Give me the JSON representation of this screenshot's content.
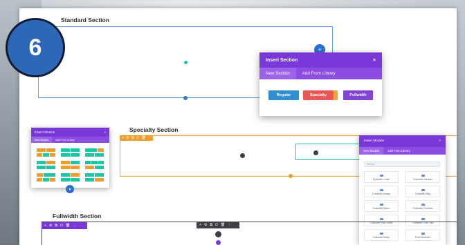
{
  "sections": {
    "standard": {
      "label": "Standard Section"
    },
    "specialty": {
      "label": "Specialty Section",
      "toolbar": "+ ⚙ ⧉ ⏻ 🗑 ⋮"
    },
    "fullwidth": {
      "label": "Fullwidth Section",
      "toolbar_left": "+ ⚙ ⧉ ⏻ 🗑 ⋮",
      "toolbar_mid": "+ ⚙ ⧉ ⏻ 🗑 ⋮"
    }
  },
  "step_badge": "6",
  "insert_section": {
    "title": "Insert Section",
    "close": "×",
    "tabs": [
      "New Section",
      "Add From Library"
    ],
    "buttons": {
      "regular": "Regular",
      "specialty": "Specialty",
      "fullwidth": "Fullwidth"
    }
  },
  "insert_columns": {
    "title": "Insert Columns",
    "close": "×",
    "tabs": [
      "New Module",
      "Add From Library"
    ]
  },
  "insert_module": {
    "title": "Insert Module",
    "close": "×",
    "tabs": [
      "New Module",
      "Add From Library"
    ],
    "search_placeholder": "Search",
    "modules": [
      "Fullwidth Code",
      "Fullwidth Header",
      "Fullwidth Image",
      "Fullwidth Map",
      "Fullwidth Menu",
      "Fullwidth Portfolio",
      "Fullwidth Post Slider",
      "Fullwidth Post Title",
      "Fullwidth Slider",
      "Post Modules"
    ]
  },
  "colors": {
    "purple": "#7b38d8",
    "blue": "#2e8fd3",
    "red": "#ea5757",
    "orange": "#f39c2d",
    "teal": "#1cc5a4",
    "dark": "#3d3f44"
  },
  "icons": {
    "add": "plus-icon",
    "chevron": "chevron-down-icon"
  }
}
